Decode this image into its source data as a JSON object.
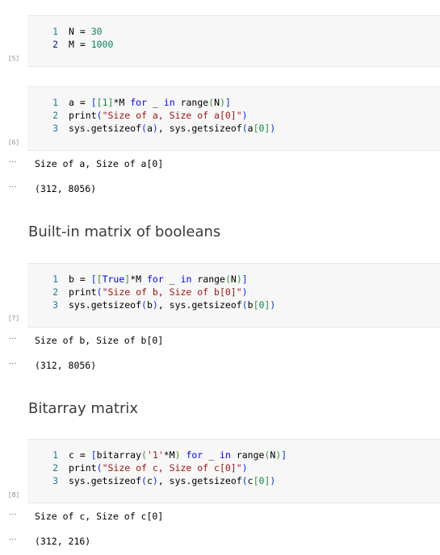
{
  "cells": [
    {
      "exec_count": "[5]",
      "lines": [
        {
          "n": "1",
          "parts": [
            [
              "",
              "N = "
            ],
            [
              "num",
              "30"
            ]
          ]
        },
        {
          "n": "2",
          "parts": [
            [
              "",
              "M = "
            ],
            [
              "num",
              "1000"
            ]
          ]
        }
      ]
    },
    {
      "exec_count": "[6]",
      "lines": [
        {
          "n": "1",
          "parts": [
            [
              "",
              "a = "
            ],
            [
              "br1",
              "["
            ],
            [
              "br2",
              "["
            ],
            [
              "num",
              "1"
            ],
            [
              "br2",
              "]"
            ],
            [
              "",
              "*M "
            ],
            [
              "kw",
              "for"
            ],
            [
              "",
              " _ "
            ],
            [
              "kw",
              "in"
            ],
            [
              "",
              " range"
            ],
            [
              "br2",
              "("
            ],
            [
              "",
              "N"
            ],
            [
              "br2",
              ")"
            ],
            [
              "br1",
              "]"
            ]
          ]
        },
        {
          "n": "2",
          "parts": [
            [
              "",
              "print"
            ],
            [
              "br1",
              "("
            ],
            [
              "str",
              "\"Size of a, Size of a[0]\""
            ],
            [
              "br1",
              ")"
            ]
          ]
        },
        {
          "n": "3",
          "parts": [
            [
              "",
              "sys.getsizeof"
            ],
            [
              "br1",
              "("
            ],
            [
              "",
              "a"
            ],
            [
              "br1",
              ")"
            ],
            [
              "",
              ", sys.getsizeof"
            ],
            [
              "br1",
              "("
            ],
            [
              "",
              "a"
            ],
            [
              "br2",
              "["
            ],
            [
              "num",
              "0"
            ],
            [
              "br2",
              "]"
            ],
            [
              "br1",
              ")"
            ]
          ]
        }
      ],
      "outputs": [
        "Size of a, Size of a[0]",
        "(312, 8056)"
      ]
    },
    {
      "exec_count": "[7]",
      "lines": [
        {
          "n": "1",
          "parts": [
            [
              "",
              "b = "
            ],
            [
              "br1",
              "["
            ],
            [
              "br2",
              "["
            ],
            [
              "kw",
              "True"
            ],
            [
              "br2",
              "]"
            ],
            [
              "",
              "*M "
            ],
            [
              "kw",
              "for"
            ],
            [
              "",
              " _ "
            ],
            [
              "kw",
              "in"
            ],
            [
              "",
              " range"
            ],
            [
              "br2",
              "("
            ],
            [
              "",
              "N"
            ],
            [
              "br2",
              ")"
            ],
            [
              "br1",
              "]"
            ]
          ]
        },
        {
          "n": "2",
          "parts": [
            [
              "",
              "print"
            ],
            [
              "br1",
              "("
            ],
            [
              "str",
              "\"Size of b, Size of b[0]\""
            ],
            [
              "br1",
              ")"
            ]
          ]
        },
        {
          "n": "3",
          "parts": [
            [
              "",
              "sys.getsizeof"
            ],
            [
              "br1",
              "("
            ],
            [
              "",
              "b"
            ],
            [
              "br1",
              ")"
            ],
            [
              "",
              ", sys.getsizeof"
            ],
            [
              "br1",
              "("
            ],
            [
              "",
              "b"
            ],
            [
              "br2",
              "["
            ],
            [
              "num",
              "0"
            ],
            [
              "br2",
              "]"
            ],
            [
              "br1",
              ")"
            ]
          ]
        }
      ],
      "outputs": [
        "Size of b, Size of b[0]",
        "(312, 8056)"
      ]
    },
    {
      "exec_count": "[8]",
      "lines": [
        {
          "n": "1",
          "parts": [
            [
              "",
              "c = "
            ],
            [
              "br1",
              "["
            ],
            [
              "",
              "bitarray"
            ],
            [
              "br2",
              "("
            ],
            [
              "str",
              "'1'"
            ],
            [
              "",
              "*M"
            ],
            [
              "br2",
              ")"
            ],
            [
              "",
              " "
            ],
            [
              "kw",
              "for"
            ],
            [
              "",
              " _ "
            ],
            [
              "kw",
              "in"
            ],
            [
              "",
              " range"
            ],
            [
              "br2",
              "("
            ],
            [
              "",
              "N"
            ],
            [
              "br2",
              ")"
            ],
            [
              "br1",
              "]"
            ]
          ]
        },
        {
          "n": "2",
          "parts": [
            [
              "",
              "print"
            ],
            [
              "br1",
              "("
            ],
            [
              "str",
              "\"Size of c, Size of c[0]\""
            ],
            [
              "br1",
              ")"
            ]
          ]
        },
        {
          "n": "3",
          "parts": [
            [
              "",
              "sys.getsizeof"
            ],
            [
              "br1",
              "("
            ],
            [
              "",
              "c"
            ],
            [
              "br1",
              ")"
            ],
            [
              "",
              ", sys.getsizeof"
            ],
            [
              "br1",
              "("
            ],
            [
              "",
              "c"
            ],
            [
              "br2",
              "["
            ],
            [
              "num",
              "0"
            ],
            [
              "br2",
              "]"
            ],
            [
              "br1",
              ")"
            ]
          ]
        }
      ],
      "outputs": [
        "Size of c, Size of c[0]",
        "(312, 216)"
      ]
    }
  ],
  "markdown": {
    "heading_b": "Built-in matrix of booleans",
    "heading_c": "Bitarray matrix"
  },
  "output_more_glyph": "···"
}
